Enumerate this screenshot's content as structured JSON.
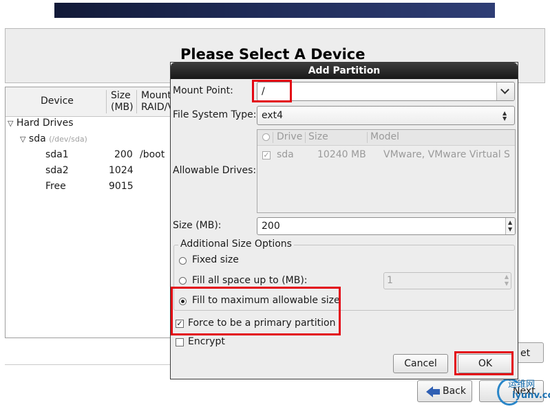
{
  "page": {
    "title": "Please Select A Device",
    "tree_headers": {
      "device": "Device",
      "size": "Size\n(MB)",
      "mount": "Mount\nRAID/V"
    },
    "tree": [
      {
        "label": "Hard Drives",
        "size": "",
        "mount": "",
        "sub": ""
      },
      {
        "label": "sda",
        "size": "",
        "mount": "",
        "sub": "(/dev/sda)"
      },
      {
        "label": "sda1",
        "size": "200",
        "mount": "/boot",
        "sub": ""
      },
      {
        "label": "sda2",
        "size": "1024",
        "mount": "",
        "sub": ""
      },
      {
        "label": "Free",
        "size": "9015",
        "mount": "",
        "sub": ""
      }
    ],
    "reset_fragment": "et",
    "back_label": "Back",
    "next_label": "Next",
    "watermark": {
      "top": "运维网",
      "bottom": "iyunv.com"
    }
  },
  "dialog": {
    "title": "Add Partition",
    "mount_point_label": "Mount Point:",
    "mount_point_value": "/",
    "fs_type_label": "File System Type:",
    "fs_type_value": "ext4",
    "allowable_drives_label": "Allowable Drives:",
    "drives_headers": [
      "Drive",
      "Size",
      "Model"
    ],
    "drives": [
      {
        "drive": "sda",
        "size": "10240 MB",
        "model": "VMware, VMware Virtual S",
        "checked": true
      }
    ],
    "size_label": "Size (MB):",
    "size_value": "200",
    "options_title": "Additional Size Options",
    "opt_fixed": "Fixed size",
    "opt_fill_upto": "Fill all space up to (MB):",
    "opt_fill_upto_value": "1",
    "opt_fill_max": "Fill to maximum allowable size",
    "selected_option": "Fill to maximum allowable size",
    "primary_label": "Force to be a primary partition",
    "primary_checked": true,
    "encrypt_label": "Encrypt",
    "encrypt_checked": false,
    "cancel_label": "Cancel",
    "ok_label": "OK"
  },
  "colors": {
    "highlight": "#e30613",
    "titlebar": "#1f1f1f",
    "dialog_bg": "#ededed"
  }
}
